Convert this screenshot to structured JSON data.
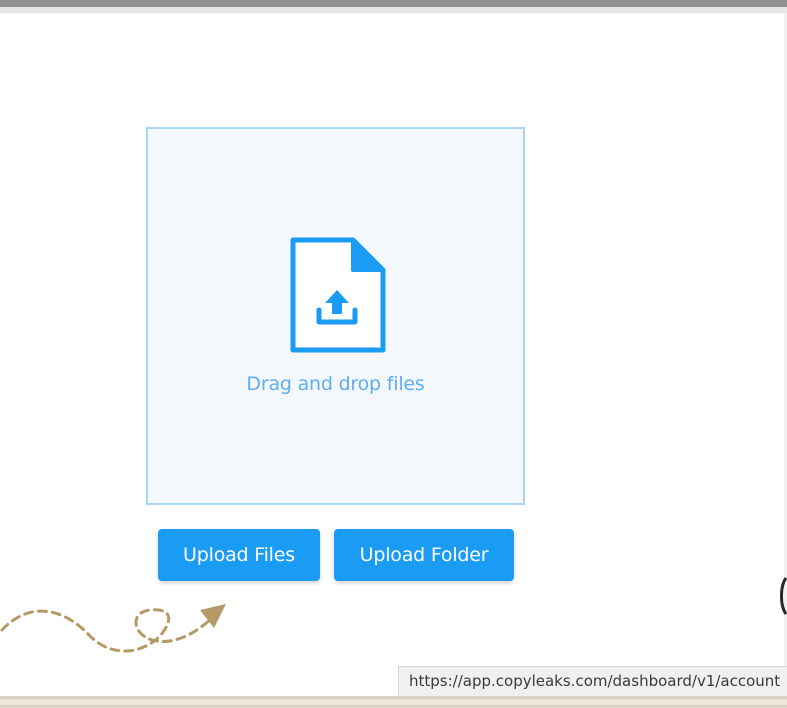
{
  "dropzone": {
    "text": "Drag and drop files",
    "icon": "file-upload-icon"
  },
  "buttons": {
    "upload_files": "Upload Files",
    "upload_folder": "Upload Folder"
  },
  "status_bar": {
    "url": "https://app.copyleaks.com/dashboard/v1/account"
  },
  "colors": {
    "accent": "#1a9cf4",
    "dropzone_border": "#a9d6f7",
    "dropzone_bg": "#f4f8fd",
    "drop_text": "#5eaef2",
    "doodle": "#b59a68"
  },
  "icons": {
    "doodle": "dashed-arrow-icon"
  }
}
